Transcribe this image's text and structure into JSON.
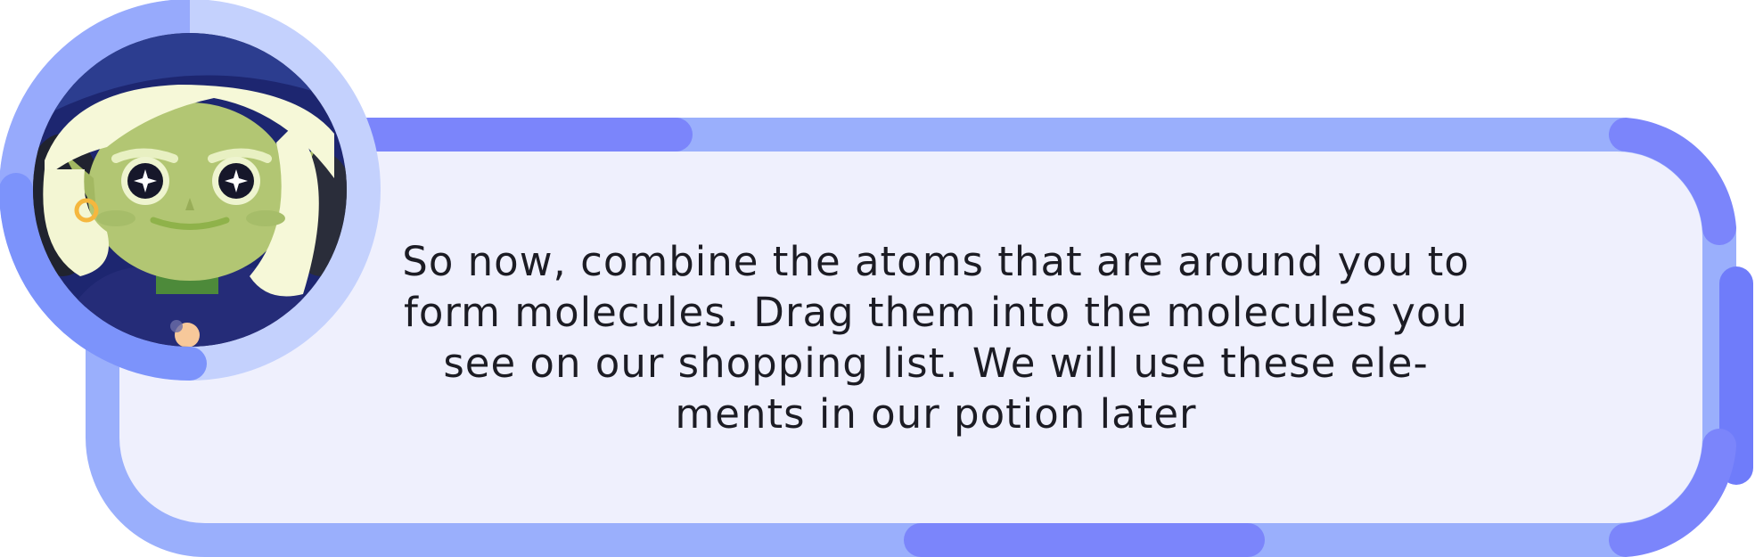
{
  "dialogue": {
    "lines": [
      "So now, combine the atoms that are around you to",
      "form molecules. Drag them into the molecules you",
      "see on our shopping list. We will use these ele-",
      "ments in our potion later"
    ]
  },
  "character": {
    "icon": "elf-character-portrait-icon"
  },
  "colors": {
    "frame_light": "#9aaffc",
    "frame_accent": "#7b85fb",
    "frame_fill": "#eff0fd",
    "portrait_ring": "#c4d1fd",
    "text": "#1c1c24"
  }
}
